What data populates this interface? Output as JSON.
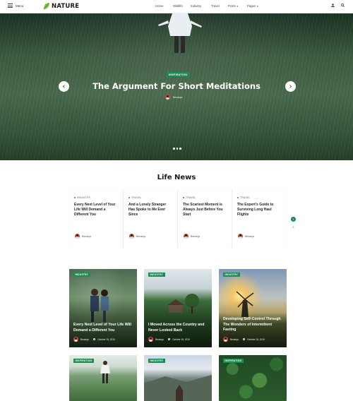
{
  "header": {
    "menu_label": "Menu",
    "logo_text": "NATURE",
    "nav": [
      {
        "label": "Home"
      },
      {
        "label": "Wildlife"
      },
      {
        "label": "Industry"
      },
      {
        "label": "Travel"
      },
      {
        "label": "Posts"
      },
      {
        "label": "Pages"
      }
    ],
    "icons": [
      "user-icon",
      "search-icon"
    ]
  },
  "hero": {
    "badge": "INSPIRATION",
    "title": "The Argument For Short Meditations",
    "author": "Benanja",
    "slide_count": 3
  },
  "life_news": {
    "title": "Life News",
    "cards": [
      {
        "category": "INDUSTRY",
        "title": "Every Next Level of Your Life Will Demand a Different You",
        "author": "Benanja"
      },
      {
        "category": "TRAVEL",
        "title": "And a Lonely Stranger Has Spoke to Me Ever Since",
        "author": "Benanja"
      },
      {
        "category": "TRAVEL",
        "title": "The Scariest Moment is Always Just Before You Start",
        "author": "Benanja"
      },
      {
        "category": "TRAVEL",
        "title": "The Expert's Guide to Surviving Long Haul Flights",
        "author": "Benanja"
      }
    ],
    "pages": [
      "1",
      "2"
    ]
  },
  "featured": [
    {
      "badge": "INDUSTRY",
      "title": "Every Next Level of Your Life Will Demand a Different You",
      "author": "Benanja",
      "date": "October 18, 2019"
    },
    {
      "badge": "INDUSTRY",
      "title": "I Moved Across the Country and Never Looked Back",
      "author": "Benanja",
      "date": "October 18, 2019"
    },
    {
      "badge": "INDUSTRY",
      "title": "Developing Self-Control Through The Wonders of Intermittent Fasting",
      "author": "Benanja",
      "date": "October 18, 2019"
    },
    {
      "badge": "INSPIRATION"
    },
    {
      "badge": "INDUSTRY"
    },
    {
      "badge": "INSPIRATION"
    }
  ],
  "colors": {
    "accent": "#1e8a55"
  }
}
